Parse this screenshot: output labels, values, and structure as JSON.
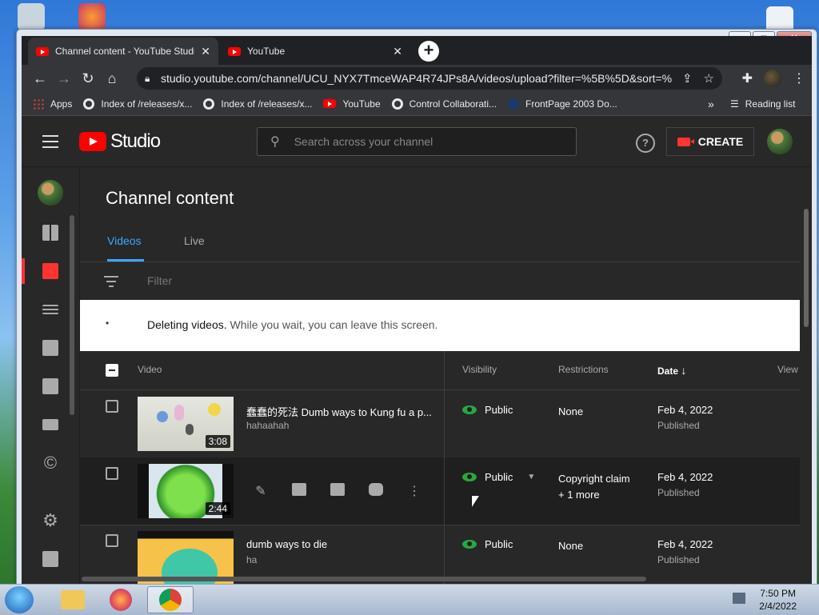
{
  "browser": {
    "tabs": [
      {
        "title": "Channel content - YouTube Studio",
        "close": "✕"
      },
      {
        "title": "YouTube",
        "close": "✕"
      }
    ],
    "new_tab": "+",
    "url": "studio.youtube.com/channel/UCU_NYX7TmceWAP4R74JPs8A/videos/upload?filter=%5B%5D&sort=%...",
    "bookmarks": [
      {
        "label": "Apps"
      },
      {
        "label": "Index of /releases/x..."
      },
      {
        "label": "Index of /releases/x..."
      },
      {
        "label": "YouTube"
      },
      {
        "label": "Control Collaborati..."
      },
      {
        "label": "FrontPage 2003 Do..."
      }
    ],
    "bookmarks_overflow": "»",
    "reading_list": "Reading list"
  },
  "studio": {
    "logo_text": "Studio",
    "search_placeholder": "Search across your channel",
    "help": "?",
    "create_label": "CREATE",
    "page_title": "Channel content",
    "tabs": [
      "Videos",
      "Live"
    ],
    "filter_placeholder": "Filter",
    "banner": {
      "dot": "•",
      "bold": "Deleting videos.",
      "rest": " While you wait, you can leave this screen."
    },
    "columns": {
      "video": "Video",
      "visibility": "Visibility",
      "restrictions": "Restrictions",
      "date": "Date",
      "date_sort": "↓",
      "views": "View"
    },
    "rows": [
      {
        "title": "蠢蠢的死法 Dumb ways to Kung fu a p...",
        "description": "hahaahah",
        "duration": "3:08",
        "visibility": "Public",
        "restrictions": "None",
        "restrictions_more": "",
        "date": "Feb 4, 2022",
        "status": "Published"
      },
      {
        "title": "",
        "description": "",
        "duration": "2:44",
        "visibility": "Public",
        "restrictions": "Copyright claim",
        "restrictions_more": "+ 1 more",
        "date": "Feb 4, 2022",
        "status": "Published"
      },
      {
        "title": "dumb ways to die",
        "description": "ha",
        "duration": "",
        "visibility": "Public",
        "restrictions": "None",
        "restrictions_more": "",
        "date": "Feb 4, 2022",
        "status": "Published"
      }
    ]
  },
  "taskbar": {
    "time": "7:50 PM",
    "date": "2/4/2022"
  },
  "colors": {
    "accent_blue": "#3ea6ff",
    "youtube_red": "#ff0000",
    "public_green": "#2ba640",
    "studio_bg": "#282828"
  }
}
